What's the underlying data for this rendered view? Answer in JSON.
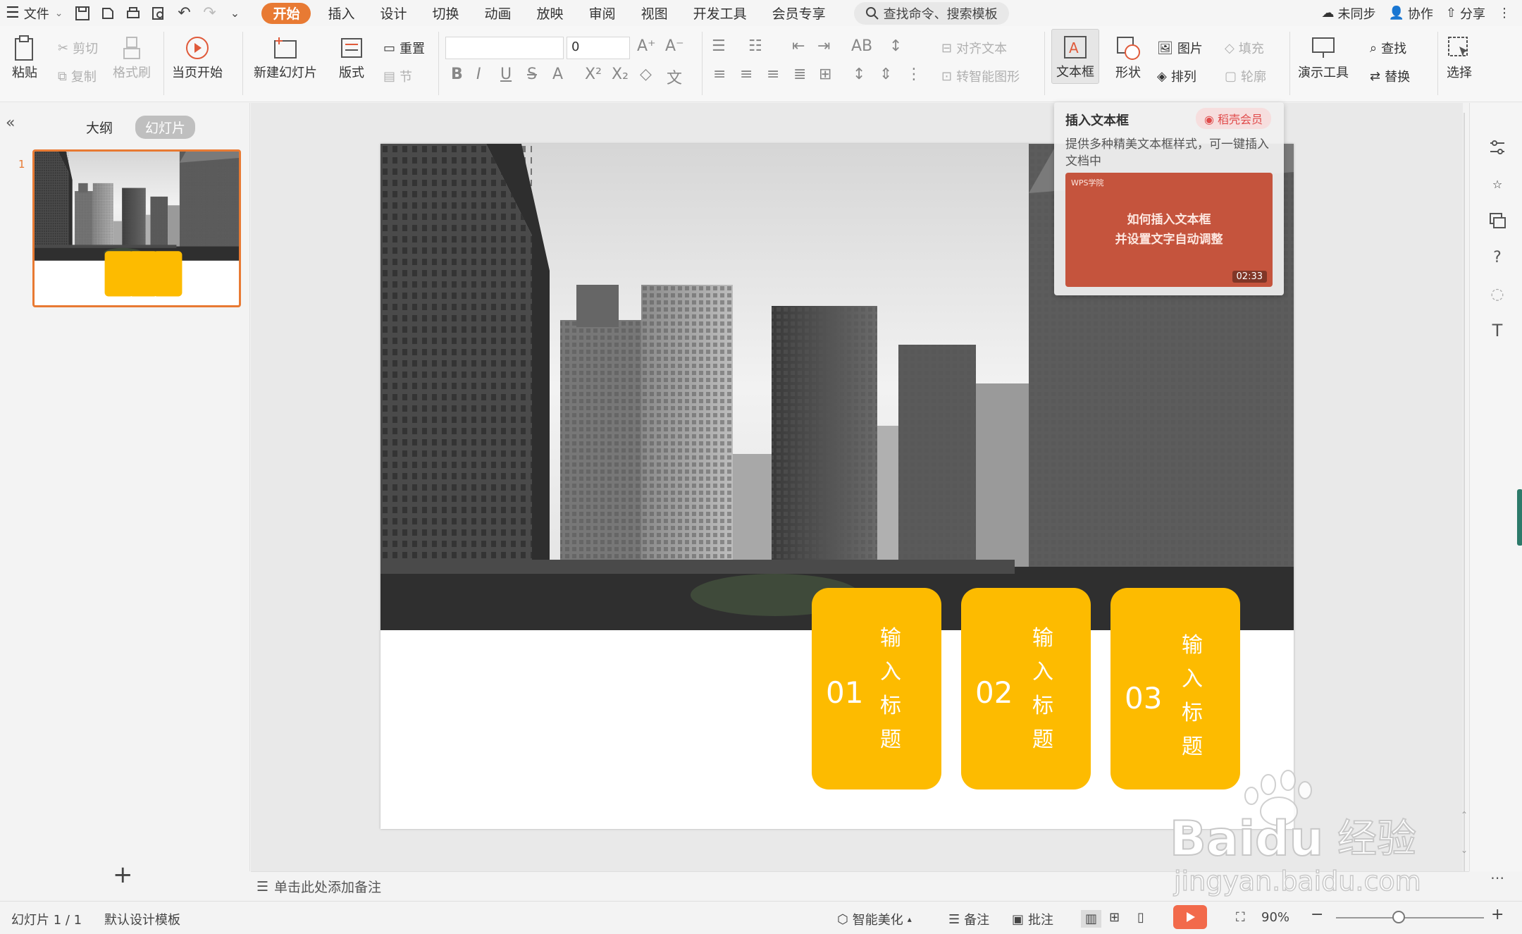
{
  "menubar": {
    "file_label": "文件",
    "tabs": [
      "开始",
      "插入",
      "设计",
      "切换",
      "动画",
      "放映",
      "审阅",
      "视图",
      "开发工具",
      "会员专享"
    ],
    "active_tab": "开始",
    "search_placeholder": "查找命令、搜索模板",
    "unsync": "未同步",
    "collab": "协作",
    "share": "分享"
  },
  "ribbon": {
    "paste": "粘贴",
    "cut": "剪切",
    "copy": "复制",
    "format_painter": "格式刷",
    "start_current": "当页开始",
    "new_slide": "新建幻灯片",
    "layout": "版式",
    "reset": "重置",
    "section": "节",
    "font_size": "0",
    "align_text": "对齐文本",
    "smart_shape": "转智能图形",
    "textbox": "文本框",
    "shape": "形状",
    "picture": "图片",
    "arrange": "排列",
    "fill": "填充",
    "outline": "轮廓",
    "present_tools": "演示工具",
    "find": "查找",
    "replace": "替换",
    "select": "选择"
  },
  "tooltip": {
    "title": "插入文本框",
    "badge": "稻壳会员",
    "desc": "提供多种精美文本框样式，可一键插入文档中",
    "video_brand": "WPS学院",
    "video_line1": "如何插入文本框",
    "video_line2": "并设置文字自动调整",
    "duration": "02:33"
  },
  "left_panel": {
    "tab_outline": "大纲",
    "tab_slides": "幻灯片",
    "slide_number": "1"
  },
  "slide": {
    "cards": [
      {
        "num": "01",
        "chars": [
          "输",
          "入",
          "标",
          "题"
        ]
      },
      {
        "num": "02",
        "chars": [
          "输",
          "入",
          "标",
          "题"
        ]
      },
      {
        "num": "03",
        "chars": [
          "输",
          "入",
          "标",
          "题"
        ]
      }
    ],
    "accent": "#fdbb00"
  },
  "notes": {
    "placeholder": "单击此处添加备注"
  },
  "status": {
    "slide_info": "幻灯片 1 / 1",
    "template": "默认设计模板",
    "beautify": "智能美化",
    "notes": "备注",
    "comments": "批注",
    "zoom": "90%"
  },
  "watermark": {
    "brand": "Baidu",
    "cn": "经验",
    "url": "jingyan.baidu.com"
  }
}
